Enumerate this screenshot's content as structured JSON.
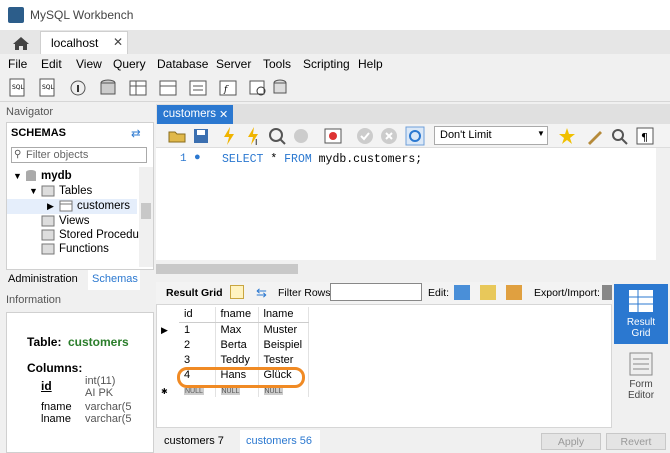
{
  "app": {
    "title": "MySQL Workbench"
  },
  "connection_tab": {
    "label": "localhost",
    "close": "✕"
  },
  "menu": [
    "File",
    "Edit",
    "View",
    "Query",
    "Database",
    "Server",
    "Tools",
    "Scripting",
    "Help"
  ],
  "navigator": {
    "header": "Navigator",
    "schemas_title": "SCHEMAS",
    "filter_placeholder": "Filter objects",
    "tree": {
      "db": "mydb",
      "tables": "Tables",
      "table": "customers",
      "views": "Views",
      "procs": "Stored Procedur",
      "funcs": "Functions"
    },
    "tabs": [
      "Administration",
      "Schemas"
    ]
  },
  "information": {
    "header": "Information",
    "table_label": "Table:",
    "table_name": "customers",
    "columns_label": "Columns:",
    "columns": [
      {
        "name": "id",
        "type": "int(11)",
        "extra": "AI PK"
      },
      {
        "name": "fname",
        "type": "varchar(5"
      },
      {
        "name": "lname",
        "type": "varchar(5"
      }
    ]
  },
  "query_tab": {
    "label": "customers",
    "close": "✕"
  },
  "query_toolbar": {
    "limit": "Don't Limit"
  },
  "editor": {
    "line": "1",
    "sql_keyword1": "SELECT",
    "sql_star": "*",
    "sql_keyword2": "FROM",
    "sql_rest": "mydb.customers;"
  },
  "result_toolbar": {
    "grid": "Result Grid",
    "filter_label": "Filter Rows:",
    "edit": "Edit:",
    "export": "Export/Import:"
  },
  "grid": {
    "columns": [
      "id",
      "fname",
      "lname"
    ],
    "rows": [
      [
        "1",
        "Max",
        "Muster"
      ],
      [
        "2",
        "Berta",
        "Beispiel"
      ],
      [
        "3",
        "Teddy",
        "Tester"
      ],
      [
        "4",
        "Hans",
        "Glück"
      ]
    ],
    "null": "NULL"
  },
  "side_panel": {
    "result_grid": "Result\nGrid",
    "form_editor": "Form\nEditor"
  },
  "bottom_tabs": [
    "customers 7",
    "customers 56"
  ],
  "actions": {
    "apply": "Apply",
    "revert": "Revert"
  },
  "colors": {
    "accent": "#2b78d0",
    "highlight": "#f08a24",
    "table_green": "#2a7d2a"
  }
}
